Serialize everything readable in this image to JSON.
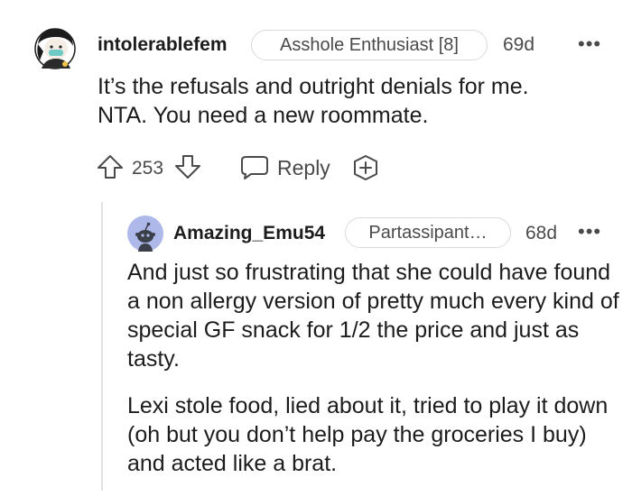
{
  "comment": {
    "username": "intolerablefem",
    "flair": "Asshole Enthusiast [8]",
    "age": "69d",
    "more": "•••",
    "body": [
      "It’s the refusals and outright denials for me.",
      "NTA. You need a new roommate."
    ],
    "score": "253",
    "reply_label": "Reply"
  },
  "reply": {
    "username": "Amazing_Emu54",
    "flair": "Partassipant…",
    "age": "68d",
    "more": "•••",
    "paragraphs": [
      "And just so frustrating that she could have found a non allergy version of pretty much every kind of special GF snack for 1/2 the price and just as tasty.",
      "Lexi stole food, lied about it, tried to play it down (oh but you don’t help pay the groceries I buy) and acted like a brat."
    ]
  },
  "icons": {
    "upvote": "upvote-arrow-icon",
    "downvote": "downvote-arrow-icon",
    "reply": "speech-bubble-icon",
    "award": "award-plus-icon"
  },
  "colors": {
    "text": "#1c1c1c",
    "meta": "#4a4a4a",
    "border": "#d9d9d9",
    "avatar_blue": "#aeb9ea"
  }
}
